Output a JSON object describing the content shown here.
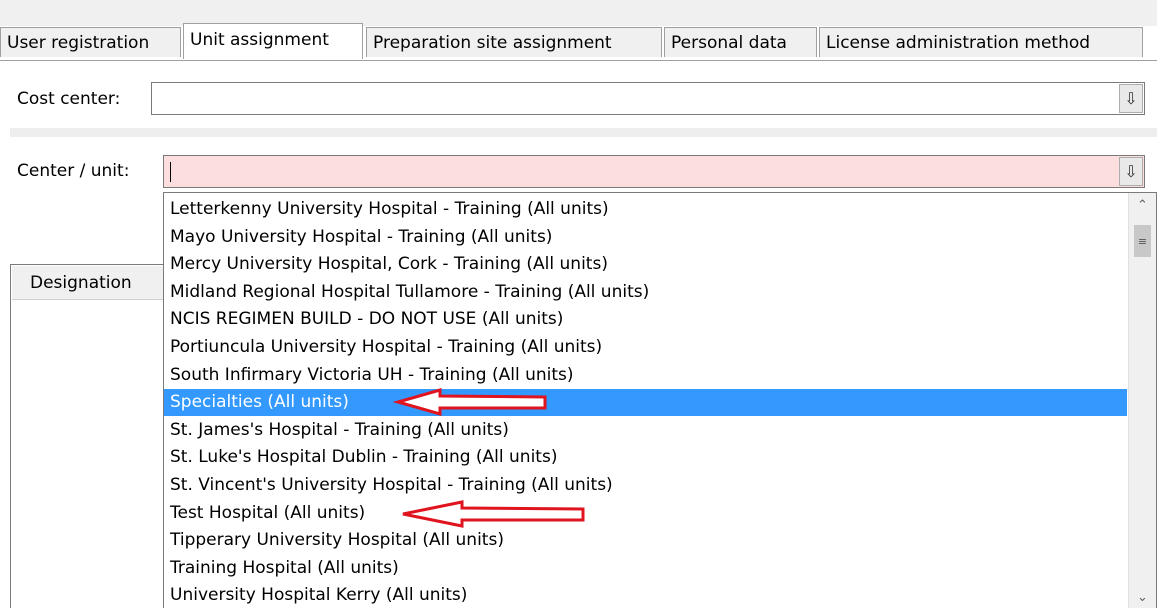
{
  "tabs": [
    {
      "label": "User registration",
      "active": false
    },
    {
      "label": "Unit assignment",
      "active": true
    },
    {
      "label": "Preparation site assignment",
      "active": false
    },
    {
      "label": "Personal data",
      "active": false
    },
    {
      "label": "License administration method",
      "active": false
    }
  ],
  "cost_center": {
    "label": "Cost center:",
    "value": "",
    "button_icon": "dropdown-arrow-icon"
  },
  "center_unit": {
    "label": "Center / unit:",
    "value": "",
    "field_color": "#fddede",
    "button_icon": "dropdown-arrow-icon"
  },
  "designation": {
    "header": "Designation"
  },
  "dropdown": {
    "selected_color": "#3399ff",
    "items": [
      "Letterkenny University Hospital - Training (All units)",
      "Mayo University Hospital - Training (All units)",
      "Mercy University Hospital, Cork - Training (All units)",
      "Midland Regional Hospital Tullamore - Training (All units)",
      "NCIS REGIMEN BUILD - DO NOT USE (All units)",
      "Portiuncula University Hospital - Training (All units)",
      "South Infirmary Victoria UH - Training (All units)",
      "Specialties (All units)",
      "St. James's Hospital - Training (All units)",
      "St. Luke's Hospital Dublin - Training (All units)",
      "St. Vincent's University Hospital - Training (All units)",
      "Test Hospital (All units)",
      "Tipperary University Hospital (All units)",
      "Training Hospital (All units)",
      "University Hospital Kerry (All units)"
    ],
    "selected_index": 7
  },
  "annotations": {
    "arrow_color": "#e0141e"
  }
}
